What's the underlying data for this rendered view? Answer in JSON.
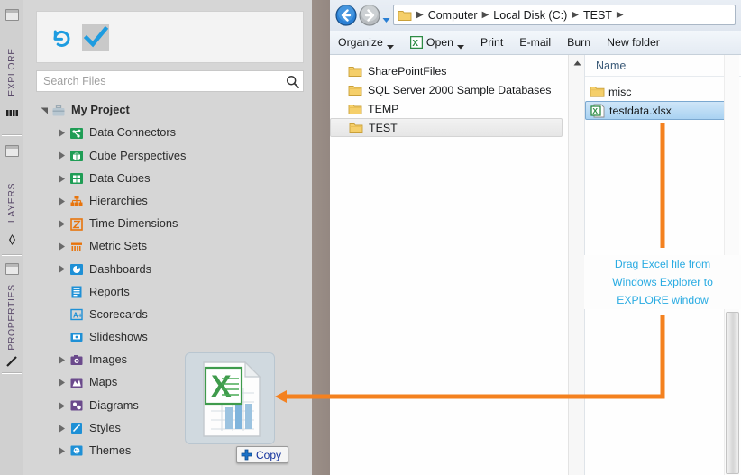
{
  "app": {
    "rail_tabs": [
      {
        "label": "EXPLORE",
        "icon": "panel-icon",
        "glyph": "▓▓"
      },
      {
        "label": "LAYERS",
        "icon": "panel-icon",
        "glyph": "❖"
      },
      {
        "label": "PROPERTIES",
        "icon": "panel-icon",
        "glyph": "╱"
      }
    ],
    "toolbar": {
      "refresh_label": "refresh-icon",
      "check_label": "checkmark-icon"
    },
    "search": {
      "placeholder": "Search Files",
      "value": "",
      "icon": "search-icon"
    },
    "tree": {
      "root": {
        "label": "My Project",
        "icon": "briefcase-icon",
        "expanded": true
      },
      "items": [
        {
          "label": "Data Connectors",
          "icon": "data-connectors-icon",
          "color": "#1f9d55",
          "caret": true
        },
        {
          "label": "Cube Perspectives",
          "icon": "cube-perspectives-icon",
          "color": "#1f9d55",
          "caret": true
        },
        {
          "label": "Data Cubes",
          "icon": "data-cubes-icon",
          "color": "#1f9d55",
          "caret": true
        },
        {
          "label": "Hierarchies",
          "icon": "hierarchies-icon",
          "color": "#e8740c",
          "caret": true
        },
        {
          "label": "Time Dimensions",
          "icon": "time-dimensions-icon",
          "color": "#e8740c",
          "caret": true
        },
        {
          "label": "Metric Sets",
          "icon": "metric-sets-icon",
          "color": "#e8740c",
          "caret": true
        },
        {
          "label": "Dashboards",
          "icon": "dashboards-icon",
          "color": "#1e90d6",
          "caret": true
        },
        {
          "label": "Reports",
          "icon": "reports-icon",
          "color": "#1e90d6",
          "caret": false
        },
        {
          "label": "Scorecards",
          "icon": "scorecards-icon",
          "color": "#1e90d6",
          "caret": false
        },
        {
          "label": "Slideshows",
          "icon": "slideshows-icon",
          "color": "#1e90d6",
          "caret": false
        },
        {
          "label": "Images",
          "icon": "images-icon",
          "color": "#6b4a8c",
          "caret": true
        },
        {
          "label": "Maps",
          "icon": "maps-icon",
          "color": "#6b4a8c",
          "caret": true
        },
        {
          "label": "Diagrams",
          "icon": "diagrams-icon",
          "color": "#6b4a8c",
          "caret": true
        },
        {
          "label": "Styles",
          "icon": "styles-icon",
          "color": "#1e90d6",
          "caret": true
        },
        {
          "label": "Themes",
          "icon": "themes-icon",
          "color": "#1e90d6",
          "caret": true
        }
      ]
    },
    "drag": {
      "ghost_icon": "excel-file-icon",
      "copy_label": "Copy",
      "copy_plus_icon": "plus-icon"
    }
  },
  "explorer": {
    "nav": {
      "back_icon": "back-arrow-icon",
      "forward_icon": "forward-arrow-icon",
      "history_icon": "chevron-down-icon",
      "address_folder_icon": "folder-icon",
      "breadcrumbs": [
        "Computer",
        "Local Disk (C:)",
        "TEST"
      ]
    },
    "commands": [
      {
        "label": "Organize",
        "has_arrow": true,
        "icon": ""
      },
      {
        "label": "Open",
        "has_arrow": true,
        "icon": "excel-small-icon"
      },
      {
        "label": "Print",
        "has_arrow": false,
        "icon": ""
      },
      {
        "label": "E-mail",
        "has_arrow": false,
        "icon": ""
      },
      {
        "label": "Burn",
        "has_arrow": false,
        "icon": ""
      },
      {
        "label": "New folder",
        "has_arrow": false,
        "icon": ""
      }
    ],
    "tree_items": [
      {
        "label": "SharePointFiles",
        "selected": false
      },
      {
        "label": "SQL Server 2000 Sample Databases",
        "selected": false
      },
      {
        "label": "TEMP",
        "selected": false
      },
      {
        "label": "TEST",
        "selected": true
      }
    ],
    "list": {
      "column_header": "Name",
      "rows": [
        {
          "label": "misc",
          "type": "folder",
          "selected": false
        },
        {
          "label": "testdata.xlsx",
          "type": "excel",
          "selected": true
        }
      ]
    },
    "scrollbar": {
      "up_icon": "scroll-up-icon"
    }
  },
  "annotation": {
    "color": "#29abe2",
    "arrow_color": "#f4811f",
    "lines": [
      "Drag Excel file from",
      "Windows Explorer to",
      "EXPLORE window"
    ]
  }
}
